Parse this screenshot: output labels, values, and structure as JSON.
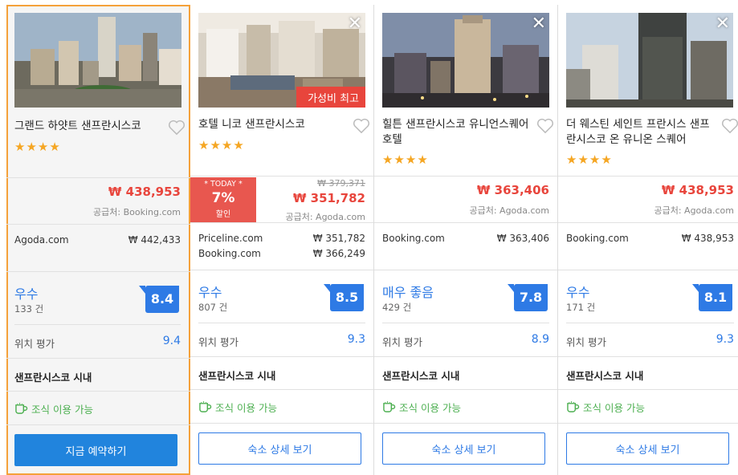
{
  "currency_symbol": "₩",
  "colors": {
    "accent_blue": "#2e7ae5",
    "price_red": "#e8453c",
    "selected_border": "#f5a13a",
    "breakfast_green": "#4caf50",
    "star_orange": "#f5a623"
  },
  "hotels": [
    {
      "name": "그랜드 하얏트 샌프란시스코",
      "stars": "★★★★",
      "price": "₩ 438,953",
      "price_source": "공급처: Booking.com",
      "offers": [
        {
          "site": "Agoda.com",
          "amount": "₩ 442,433"
        }
      ],
      "rating_word": "우수",
      "review_count": "133 건",
      "score": "8.4",
      "location_label": "위치 평가",
      "location_score": "9.4",
      "district": "샌프란시스코 시내",
      "breakfast": "조식 이용 가능",
      "cta": "지금 예약하기"
    },
    {
      "name": "호텔 니코 샌프란시스코",
      "badge": "가성비 최고",
      "stars": "★★★★",
      "today_label": "* TODAY *",
      "today_percent": "7%",
      "today_discount": "할인",
      "price_strike": "₩ 379,371",
      "price": "₩ 351,782",
      "price_source": "공급처: Agoda.com",
      "offers": [
        {
          "site": "Priceline.com",
          "amount": "₩  351,782"
        },
        {
          "site": "Booking.com",
          "amount": "₩  366,249"
        }
      ],
      "rating_word": "우수",
      "review_count": "807 건",
      "score": "8.5",
      "location_label": "위치 평가",
      "location_score": "9.3",
      "district": "샌프란시스코 시내",
      "breakfast": "조식 이용 가능",
      "cta": "숙소 상세 보기"
    },
    {
      "name": "힐튼 샌프란시스코 유니언스퀘어 호텔",
      "stars": "★★★★",
      "price": "₩ 363,406",
      "price_source": "공급처: Agoda.com",
      "offers": [
        {
          "site": "Booking.com",
          "amount": "₩ 363,406"
        }
      ],
      "rating_word": "매우 좋음",
      "review_count": "429 건",
      "score": "7.8",
      "location_label": "위치 평가",
      "location_score": "8.9",
      "district": "샌프란시스코 시내",
      "breakfast": "조식 이용 가능",
      "cta": "숙소 상세 보기"
    },
    {
      "name": "더 웨스틴 세인트 프란시스 샌프란시스코 온 유니온 스퀘어",
      "stars": "★★★★",
      "price": "₩ 438,953",
      "price_source": "공급처: Agoda.com",
      "offers": [
        {
          "site": "Booking.com",
          "amount": "₩ 438,953"
        }
      ],
      "rating_word": "우수",
      "review_count": "171 건",
      "score": "8.1",
      "location_label": "위치 평가",
      "location_score": "9.3",
      "district": "샌프란시스코 시내",
      "breakfast": "조식 이용 가능",
      "cta": "숙소 상세 보기"
    }
  ]
}
